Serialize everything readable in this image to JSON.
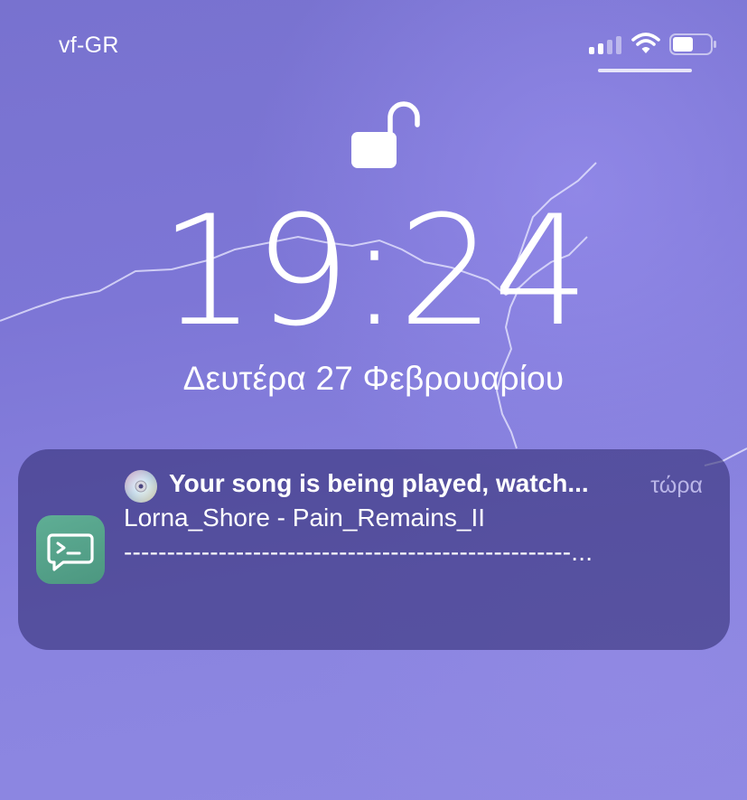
{
  "status_bar": {
    "carrier": "vf-GR",
    "signal_icon": "signal-icon",
    "wifi_icon": "wifi-icon",
    "battery_icon": "battery-icon",
    "battery_level": 0.5
  },
  "lock_screen": {
    "lock_icon": "unlocked-padlock-icon",
    "time": "19:24",
    "date": "Δευτέρα 27 Φεβρουαρίου"
  },
  "notification": {
    "app_icon": "terminal-icon",
    "title_icon": "cd-icon",
    "title": "Your song is being played, watch...",
    "time": "τώρα",
    "line1": "Lorna_Shore - Pain_Remains_II",
    "line2": "----------------------------------------------------..."
  },
  "colors": {
    "background": "#7d76d6",
    "notification_bg": "#363078",
    "app_icon": "#55a28a"
  }
}
